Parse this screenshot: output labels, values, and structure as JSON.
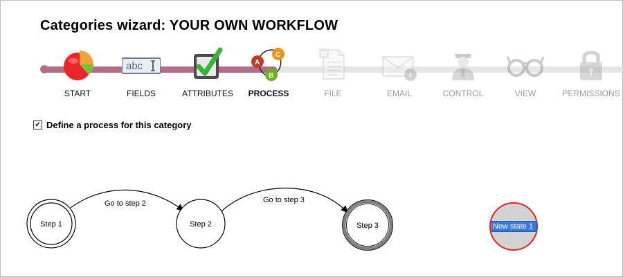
{
  "page": {
    "title": "Categories wizard:  YOUR OWN WORKFLOW"
  },
  "wizard": {
    "steps": [
      {
        "label": "START",
        "icon": "pie-chart-icon",
        "state": "done"
      },
      {
        "label": "FIELDS",
        "icon": "text-field-icon",
        "state": "done"
      },
      {
        "label": "ATTRIBUTES",
        "icon": "checkbox-icon",
        "state": "done"
      },
      {
        "label": "PROCESS",
        "icon": "process-abc-icon",
        "state": "current"
      },
      {
        "label": "FILE",
        "icon": "word-document-icon",
        "state": "disabled"
      },
      {
        "label": "EMAIL",
        "icon": "email-info-icon",
        "state": "disabled"
      },
      {
        "label": "CONTROL",
        "icon": "officer-icon",
        "state": "disabled"
      },
      {
        "label": "VIEW",
        "icon": "glasses-icon",
        "state": "disabled"
      },
      {
        "label": "PERMISSIONS",
        "icon": "padlock-icon",
        "state": "disabled"
      }
    ],
    "colors": {
      "active_track": "#b06f86",
      "inactive_track": "#e6e6e6"
    }
  },
  "process_option": {
    "checked": true,
    "check_mark": "✔",
    "label": "Define a process for this category"
  },
  "process_diagram": {
    "states": [
      {
        "label": "Step 1",
        "style": "initial"
      },
      {
        "label": "Step 2",
        "style": "normal"
      },
      {
        "label": "Step 3",
        "style": "final"
      },
      {
        "label": "New state 1",
        "style": "new-editing"
      }
    ],
    "transitions": [
      {
        "from": "Step 1",
        "to": "Step 2",
        "label": "Go to step 2"
      },
      {
        "from": "Step 2",
        "to": "Step 3",
        "label": "Go to step 3"
      }
    ],
    "colors": {
      "new_state_fill": "#d3d3d3",
      "new_state_border": "#e02020",
      "final_ring": "#808080"
    }
  }
}
